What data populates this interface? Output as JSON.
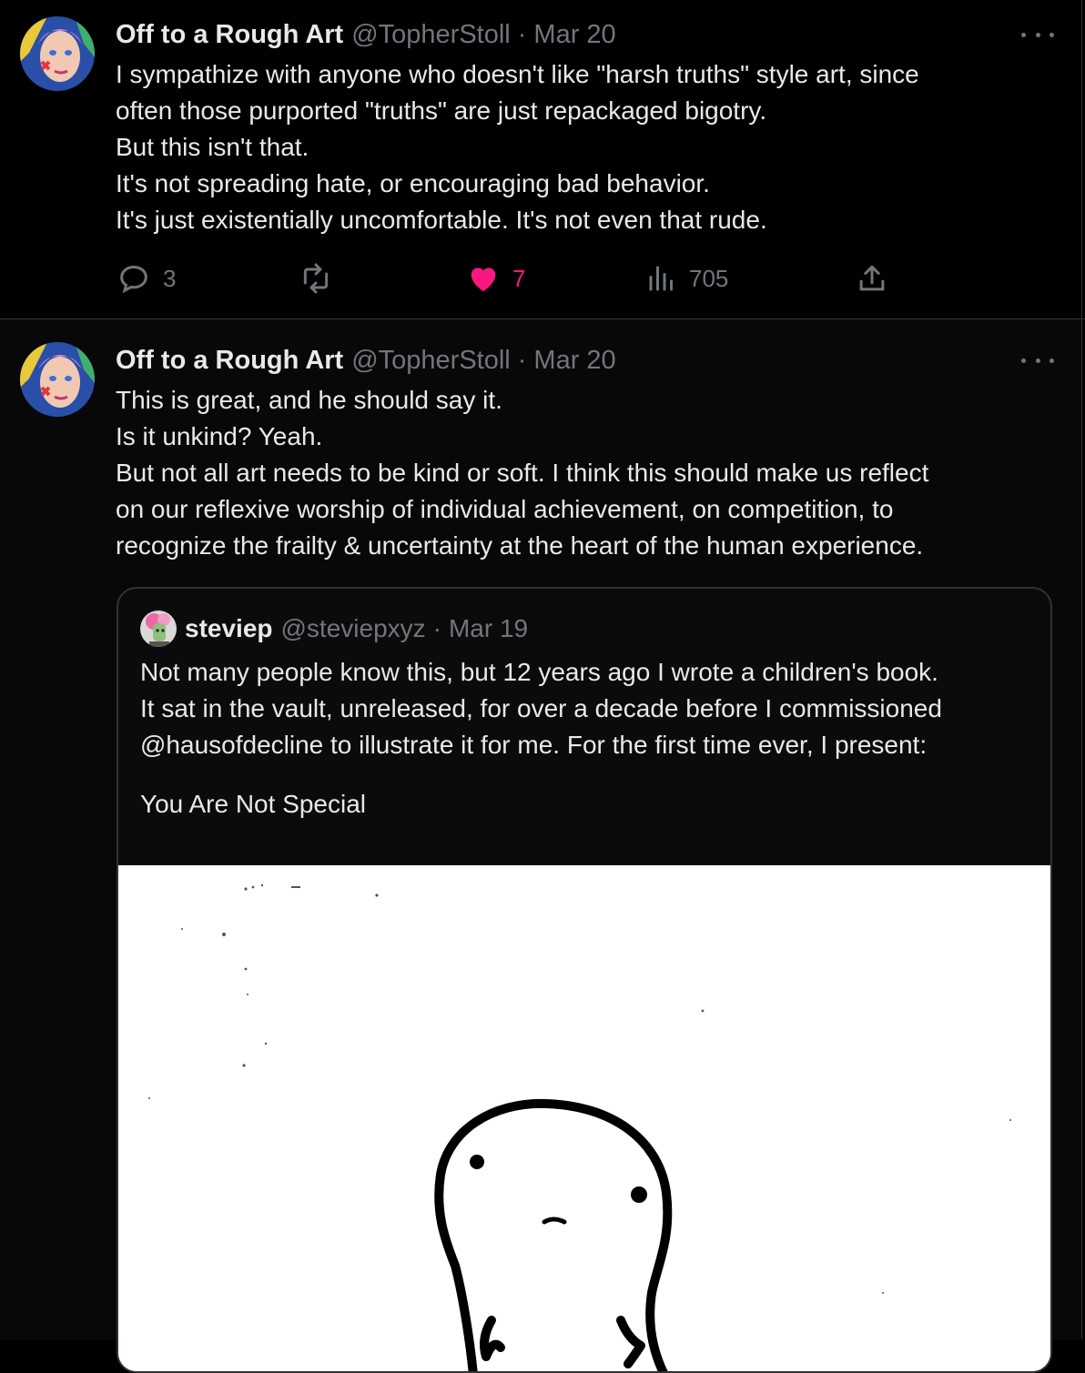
{
  "tweets": [
    {
      "author_name": "Off to a Rough Art",
      "handle": "@TopherStoll",
      "separator": "·",
      "date": "Mar 20",
      "lines": [
        "I sympathize with anyone who doesn't like \"harsh truths\" style art, since",
        "often those purported \"truths\" are just repackaged bigotry.",
        "But this isn't that.",
        "It's not spreading hate, or encouraging bad behavior.",
        "It's just existentially uncomfortable. It's not even that rude."
      ],
      "replies": "3",
      "reposts": "",
      "likes": "7",
      "views": "705"
    },
    {
      "author_name": "Off to a Rough Art",
      "handle": "@TopherStoll",
      "separator": "·",
      "date": "Mar 20",
      "lines": [
        "This is great, and he should say it.",
        "Is it unkind? Yeah.",
        "But not all art needs to be kind or soft. I think this should make us reflect",
        "on our reflexive worship of individual achievement, on competition, to",
        "recognize the frailty & uncertainty at the heart of the human experience."
      ],
      "quote": {
        "author_name": "steviep",
        "handle": "@steviepxyz",
        "separator": "·",
        "date": "Mar 19",
        "lines": [
          "Not many people know this, but 12 years ago I wrote a children's book.",
          "It sat in the vault, unreleased, for over a decade before I commissioned",
          "@hausofdecline to illustrate it for me. For the first time ever, I present:"
        ],
        "title_line": "You Are Not Special"
      }
    }
  ],
  "colors": {
    "background": "#000000",
    "text": "#e7e9ea",
    "muted": "#71767b",
    "like_pink": "#f91880",
    "border": "#2f3336"
  },
  "icons": [
    "reply-icon",
    "repost-icon",
    "like-icon",
    "views-icon",
    "share-icon",
    "more-icon"
  ]
}
